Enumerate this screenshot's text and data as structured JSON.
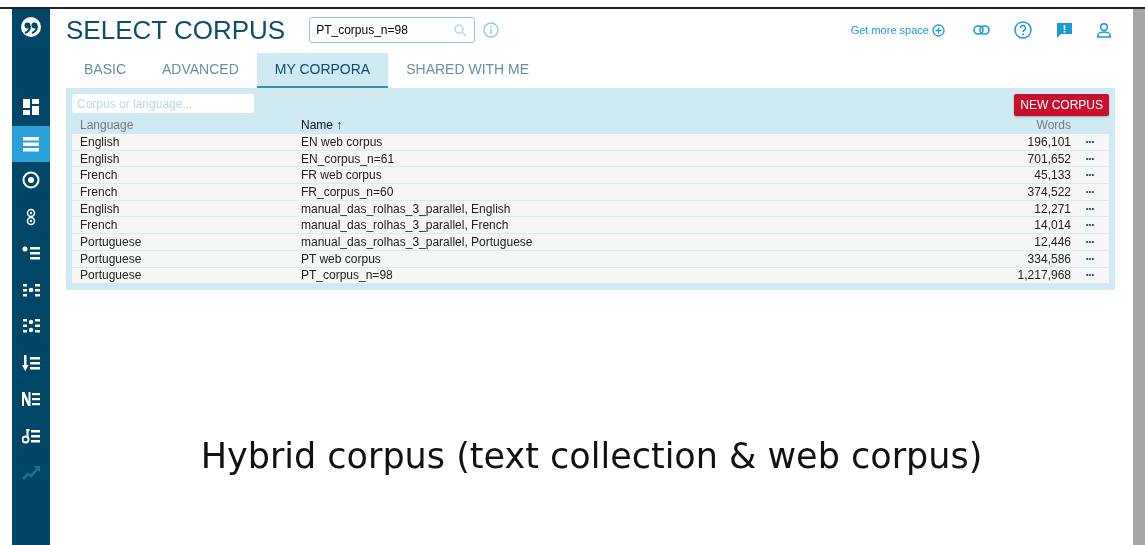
{
  "header": {
    "title": "SELECT CORPUS",
    "search": {
      "value": "PT_corpus_n=98"
    },
    "get_more_space": "Get more space"
  },
  "sidebar": {
    "items": [
      {
        "kind": "dashboard",
        "selected": false,
        "disabled": false
      },
      {
        "kind": "list",
        "selected": true,
        "disabled": false
      },
      {
        "kind": "target",
        "selected": false,
        "disabled": false
      },
      {
        "kind": "pair",
        "selected": false,
        "disabled": false
      },
      {
        "kind": "bullet",
        "selected": false,
        "disabled": false
      },
      {
        "kind": "dots",
        "selected": false,
        "disabled": false
      },
      {
        "kind": "grid",
        "selected": false,
        "disabled": false
      },
      {
        "kind": "sort",
        "selected": false,
        "disabled": false
      },
      {
        "kind": "ngram",
        "selected": false,
        "disabled": false
      },
      {
        "kind": "key",
        "selected": false,
        "disabled": false
      },
      {
        "kind": "trend",
        "selected": false,
        "disabled": true
      }
    ]
  },
  "tabs": [
    {
      "label": "BASIC",
      "selected": false
    },
    {
      "label": "ADVANCED",
      "selected": false
    },
    {
      "label": "MY CORPORA",
      "selected": true
    },
    {
      "label": "SHARED WITH ME",
      "selected": false
    }
  ],
  "filter": {
    "placeholder": "Corpus or language..."
  },
  "new_corpus_button": "NEW CORPUS",
  "table": {
    "columns": [
      {
        "label": "Language",
        "sorted": false
      },
      {
        "label": "Name ↑",
        "sorted": true
      },
      {
        "label": "Words",
        "sorted": false
      }
    ],
    "rows": [
      {
        "language": "English",
        "name": "EN web corpus",
        "words": "196,101",
        "menu": "•••"
      },
      {
        "language": "English",
        "name": "EN_corpus_n=61",
        "words": "701,652",
        "menu": "•••"
      },
      {
        "language": "French",
        "name": "FR web corpus",
        "words": "45,133",
        "menu": "•••"
      },
      {
        "language": "French",
        "name": "FR_corpus_n=60",
        "words": "374,522",
        "menu": "•••"
      },
      {
        "language": "English",
        "name": "manual_das_rolhas_3_parallel, English",
        "words": "12,271",
        "menu": "•••"
      },
      {
        "language": "French",
        "name": "manual_das_rolhas_3_parallel, French",
        "words": "14,014",
        "menu": "•••"
      },
      {
        "language": "Portuguese",
        "name": "manual_das_rolhas_3_parallel, Portuguese",
        "words": "12,446",
        "menu": "•••"
      },
      {
        "language": "Portuguese",
        "name": "PT web corpus",
        "words": "334,586",
        "menu": "•••"
      },
      {
        "language": "Portuguese",
        "name": "PT_corpus_n=98",
        "words": "1,217,968",
        "menu": "•••"
      }
    ]
  },
  "caption": "Hybrid corpus (text collection & web corpus)"
}
